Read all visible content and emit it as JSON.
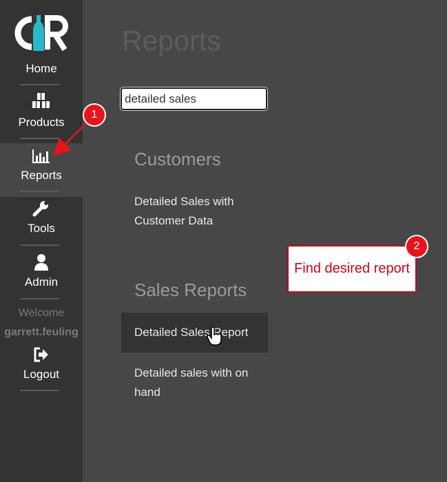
{
  "brand": {
    "logo_text": "CR",
    "accent": "#2ab7c9"
  },
  "sidebar": {
    "items": [
      {
        "label": "Home",
        "icon": "home-icon"
      },
      {
        "label": "Products",
        "icon": "boxes-icon"
      },
      {
        "label": "Reports",
        "icon": "bar-chart-icon",
        "active": true
      },
      {
        "label": "Tools",
        "icon": "wrench-icon"
      },
      {
        "label": "Admin",
        "icon": "user-icon"
      },
      {
        "label": "Logout",
        "icon": "sign-out-icon"
      }
    ],
    "welcome": "Welcome",
    "username": "garrett.feuling"
  },
  "main": {
    "title": "Reports",
    "search": {
      "value": "detailed sales"
    },
    "sections": [
      {
        "heading": "Customers",
        "reports": [
          {
            "label": "Detailed Sales with Customer Data"
          }
        ]
      },
      {
        "heading": "Sales Reports",
        "reports": [
          {
            "label": "Detailed Sales Report",
            "highlighted": true
          },
          {
            "label": "Detailed sales with on hand"
          }
        ]
      }
    ]
  },
  "annotations": {
    "badge1": "1",
    "badge2": "2",
    "callout_text": "Find desired report",
    "color": "#d0021b"
  }
}
